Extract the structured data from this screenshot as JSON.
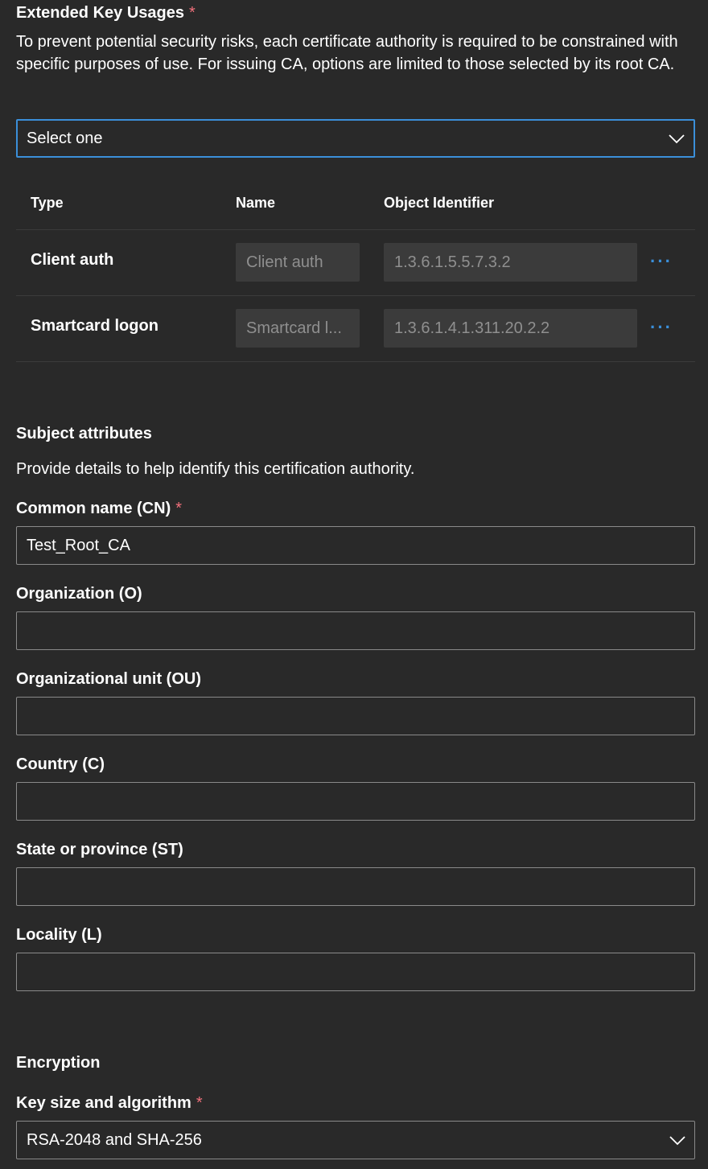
{
  "eku": {
    "label": "Extended Key Usages",
    "required_mark": "*",
    "description": "To prevent potential security risks, each certificate authority is required to be constrained with specific purposes of use. For issuing CA, options are limited to those selected by its root CA.",
    "dropdown_value": "Select one",
    "table": {
      "headers": {
        "type": "Type",
        "name": "Name",
        "oid": "Object Identifier"
      },
      "rows": [
        {
          "type": "Client auth",
          "name": "Client auth",
          "oid": "1.3.6.1.5.5.7.3.2",
          "more": "···"
        },
        {
          "type": "Smartcard logon",
          "name": "Smartcard l...",
          "oid": "1.3.6.1.4.1.311.20.2.2",
          "more": "···"
        }
      ]
    }
  },
  "subject": {
    "heading": "Subject attributes",
    "description": "Provide details to help identify this certification authority.",
    "fields": [
      {
        "label": "Common name (CN)",
        "required": "*",
        "value": "Test_Root_CA"
      },
      {
        "label": "Organization (O)",
        "value": ""
      },
      {
        "label": "Organizational unit (OU)",
        "value": ""
      },
      {
        "label": "Country (C)",
        "value": ""
      },
      {
        "label": "State or province (ST)",
        "value": ""
      },
      {
        "label": "Locality (L)",
        "value": ""
      }
    ]
  },
  "encryption": {
    "heading": "Encryption",
    "key_label": "Key size and algorithm",
    "required_mark": "*",
    "key_value": "RSA-2048 and SHA-256"
  },
  "colors": {
    "background": "#292929",
    "accent": "#3b8fd9",
    "required": "#f1707b",
    "disabled_bg": "#3b3b3b",
    "disabled_text": "#8f8f8f"
  }
}
